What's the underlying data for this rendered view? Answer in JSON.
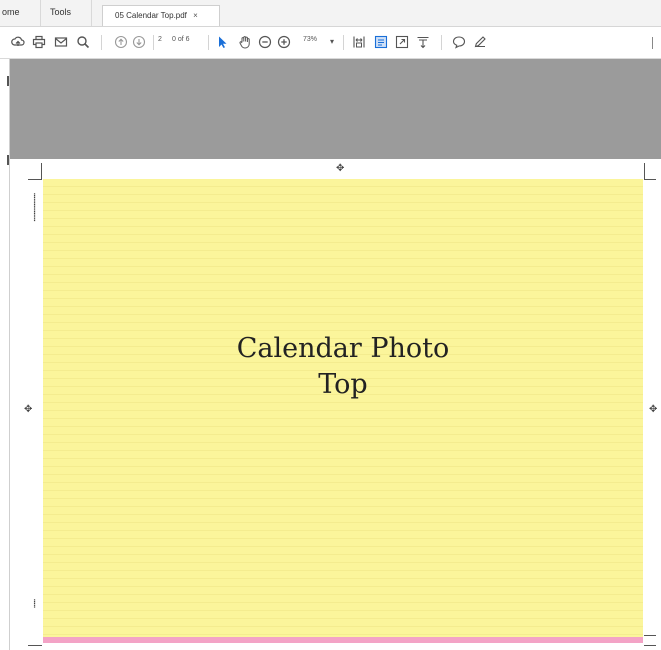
{
  "tabs": {
    "home": "ome",
    "tools": "Tools",
    "document": "05 Calendar Top.pdf",
    "close_glyph": "×"
  },
  "toolbar": {
    "page_current": "2",
    "page_total": "0 of 6",
    "zoom": "73%"
  },
  "document": {
    "title_line1": "Calendar Photo",
    "title_line2": "Top"
  },
  "colors": {
    "gray_area": "#9b9b9b",
    "page_fill": "#fbf59b",
    "bottom_strip": "#f3a3c6",
    "active_tool": "#1a6fd8"
  },
  "icons": [
    "cloud-upload-icon",
    "print-icon",
    "mail-icon",
    "search-icon",
    "page-up-icon",
    "page-down-icon",
    "select-tool-icon",
    "hand-tool-icon",
    "zoom-out-icon",
    "zoom-in-icon",
    "zoom-dropdown-icon",
    "fit-page-icon",
    "scroll-mode-icon",
    "fullscreen-icon",
    "read-mode-icon",
    "comment-icon",
    "pen-icon"
  ]
}
